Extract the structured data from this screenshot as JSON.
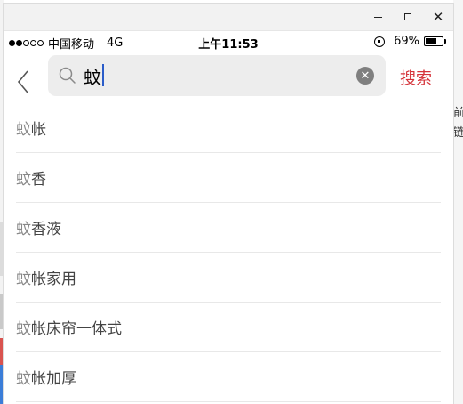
{
  "background_app": {
    "right_fragments": [
      "前",
      "链"
    ]
  },
  "window": {
    "controls": [
      "minimize",
      "maximize",
      "close"
    ]
  },
  "status_bar": {
    "signal_dots_filled": 2,
    "signal_dots_total": 5,
    "carrier": "中国移动",
    "network": "4G",
    "time": "上午11:53",
    "battery_percent": "69%",
    "battery_level": 0.69
  },
  "search": {
    "query": "蚊",
    "submit_label": "搜索",
    "accent_color": "#d5333a"
  },
  "suggestions": [
    {
      "keyword": "蚊",
      "rest": "帐"
    },
    {
      "keyword": "蚊",
      "rest": "香"
    },
    {
      "keyword": "蚊",
      "rest": "香液"
    },
    {
      "keyword": "蚊",
      "rest": "帐家用"
    },
    {
      "keyword": "蚊",
      "rest": "帐床帘一体式"
    },
    {
      "keyword": "蚊",
      "rest": "帐加厚"
    }
  ]
}
